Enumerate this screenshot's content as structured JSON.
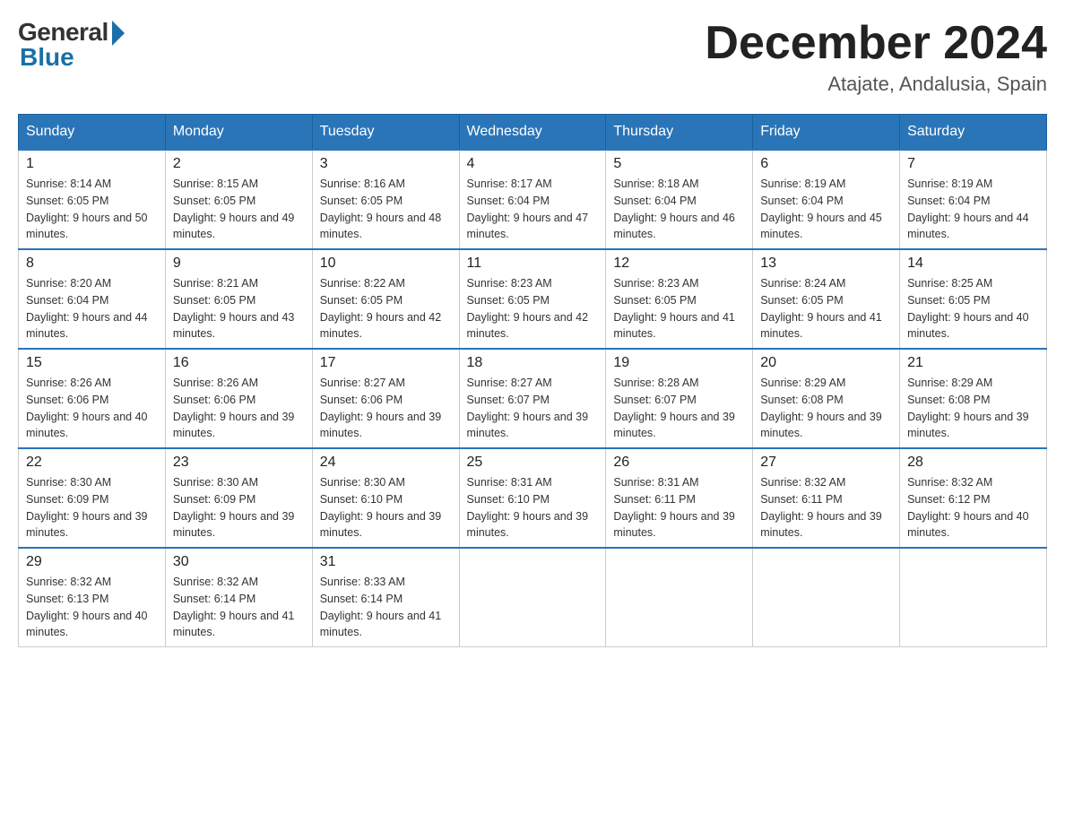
{
  "logo": {
    "general": "General",
    "blue": "Blue"
  },
  "title": {
    "month": "December 2024",
    "location": "Atajate, Andalusia, Spain"
  },
  "weekdays": [
    "Sunday",
    "Monday",
    "Tuesday",
    "Wednesday",
    "Thursday",
    "Friday",
    "Saturday"
  ],
  "weeks": [
    [
      {
        "day": "1",
        "sunrise": "8:14 AM",
        "sunset": "6:05 PM",
        "daylight": "9 hours and 50 minutes."
      },
      {
        "day": "2",
        "sunrise": "8:15 AM",
        "sunset": "6:05 PM",
        "daylight": "9 hours and 49 minutes."
      },
      {
        "day": "3",
        "sunrise": "8:16 AM",
        "sunset": "6:05 PM",
        "daylight": "9 hours and 48 minutes."
      },
      {
        "day": "4",
        "sunrise": "8:17 AM",
        "sunset": "6:04 PM",
        "daylight": "9 hours and 47 minutes."
      },
      {
        "day": "5",
        "sunrise": "8:18 AM",
        "sunset": "6:04 PM",
        "daylight": "9 hours and 46 minutes."
      },
      {
        "day": "6",
        "sunrise": "8:19 AM",
        "sunset": "6:04 PM",
        "daylight": "9 hours and 45 minutes."
      },
      {
        "day": "7",
        "sunrise": "8:19 AM",
        "sunset": "6:04 PM",
        "daylight": "9 hours and 44 minutes."
      }
    ],
    [
      {
        "day": "8",
        "sunrise": "8:20 AM",
        "sunset": "6:04 PM",
        "daylight": "9 hours and 44 minutes."
      },
      {
        "day": "9",
        "sunrise": "8:21 AM",
        "sunset": "6:05 PM",
        "daylight": "9 hours and 43 minutes."
      },
      {
        "day": "10",
        "sunrise": "8:22 AM",
        "sunset": "6:05 PM",
        "daylight": "9 hours and 42 minutes."
      },
      {
        "day": "11",
        "sunrise": "8:23 AM",
        "sunset": "6:05 PM",
        "daylight": "9 hours and 42 minutes."
      },
      {
        "day": "12",
        "sunrise": "8:23 AM",
        "sunset": "6:05 PM",
        "daylight": "9 hours and 41 minutes."
      },
      {
        "day": "13",
        "sunrise": "8:24 AM",
        "sunset": "6:05 PM",
        "daylight": "9 hours and 41 minutes."
      },
      {
        "day": "14",
        "sunrise": "8:25 AM",
        "sunset": "6:05 PM",
        "daylight": "9 hours and 40 minutes."
      }
    ],
    [
      {
        "day": "15",
        "sunrise": "8:26 AM",
        "sunset": "6:06 PM",
        "daylight": "9 hours and 40 minutes."
      },
      {
        "day": "16",
        "sunrise": "8:26 AM",
        "sunset": "6:06 PM",
        "daylight": "9 hours and 39 minutes."
      },
      {
        "day": "17",
        "sunrise": "8:27 AM",
        "sunset": "6:06 PM",
        "daylight": "9 hours and 39 minutes."
      },
      {
        "day": "18",
        "sunrise": "8:27 AM",
        "sunset": "6:07 PM",
        "daylight": "9 hours and 39 minutes."
      },
      {
        "day": "19",
        "sunrise": "8:28 AM",
        "sunset": "6:07 PM",
        "daylight": "9 hours and 39 minutes."
      },
      {
        "day": "20",
        "sunrise": "8:29 AM",
        "sunset": "6:08 PM",
        "daylight": "9 hours and 39 minutes."
      },
      {
        "day": "21",
        "sunrise": "8:29 AM",
        "sunset": "6:08 PM",
        "daylight": "9 hours and 39 minutes."
      }
    ],
    [
      {
        "day": "22",
        "sunrise": "8:30 AM",
        "sunset": "6:09 PM",
        "daylight": "9 hours and 39 minutes."
      },
      {
        "day": "23",
        "sunrise": "8:30 AM",
        "sunset": "6:09 PM",
        "daylight": "9 hours and 39 minutes."
      },
      {
        "day": "24",
        "sunrise": "8:30 AM",
        "sunset": "6:10 PM",
        "daylight": "9 hours and 39 minutes."
      },
      {
        "day": "25",
        "sunrise": "8:31 AM",
        "sunset": "6:10 PM",
        "daylight": "9 hours and 39 minutes."
      },
      {
        "day": "26",
        "sunrise": "8:31 AM",
        "sunset": "6:11 PM",
        "daylight": "9 hours and 39 minutes."
      },
      {
        "day": "27",
        "sunrise": "8:32 AM",
        "sunset": "6:11 PM",
        "daylight": "9 hours and 39 minutes."
      },
      {
        "day": "28",
        "sunrise": "8:32 AM",
        "sunset": "6:12 PM",
        "daylight": "9 hours and 40 minutes."
      }
    ],
    [
      {
        "day": "29",
        "sunrise": "8:32 AM",
        "sunset": "6:13 PM",
        "daylight": "9 hours and 40 minutes."
      },
      {
        "day": "30",
        "sunrise": "8:32 AM",
        "sunset": "6:14 PM",
        "daylight": "9 hours and 41 minutes."
      },
      {
        "day": "31",
        "sunrise": "8:33 AM",
        "sunset": "6:14 PM",
        "daylight": "9 hours and 41 minutes."
      },
      null,
      null,
      null,
      null
    ]
  ]
}
